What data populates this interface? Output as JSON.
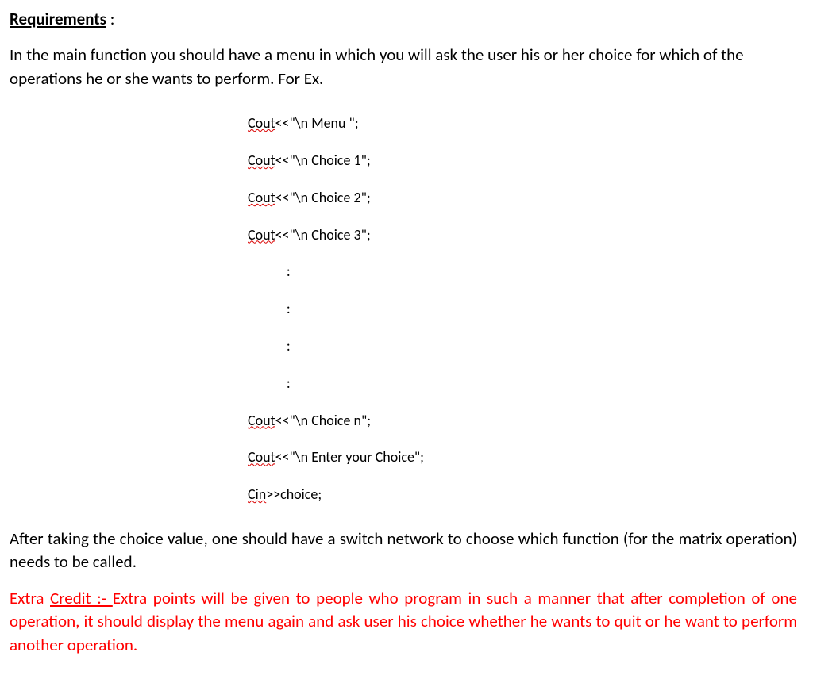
{
  "heading": {
    "text": "Requirements",
    "tail": " :"
  },
  "intro_para": "In the main function you should have a menu in which you will ask the user his or her choice for which of the operations he or she wants to perform. For Ex.",
  "code": {
    "keyword_cout": "Cout",
    "keyword_cin": "Cin",
    "line1_rest": "<<\"\\n Menu \";",
    "line2_rest": "<<\"\\n Choice 1\";",
    "line3_rest": "<<\"\\n Choice 2\";",
    "line4_rest": "<<\"\\n Choice 3\";",
    "colon": ":",
    "line5_rest": "<<\"\\n Choice n\";",
    "line6_rest": "<<\"\\n Enter your Choice\";",
    "line7_rest": ">>choice;"
  },
  "after_para": "After taking the choice value, one should have a switch network to choose which function (for the matrix operation) needs to be called.",
  "extra": {
    "lead_word": "Credit",
    "prefix": "Extra ",
    "lead_tail": " :- ",
    "body": "Extra points will be given to people who program in such a manner that after completion of one operation, it should display the menu again and ask user his choice whether he wants to quit or he want to perform another operation."
  }
}
